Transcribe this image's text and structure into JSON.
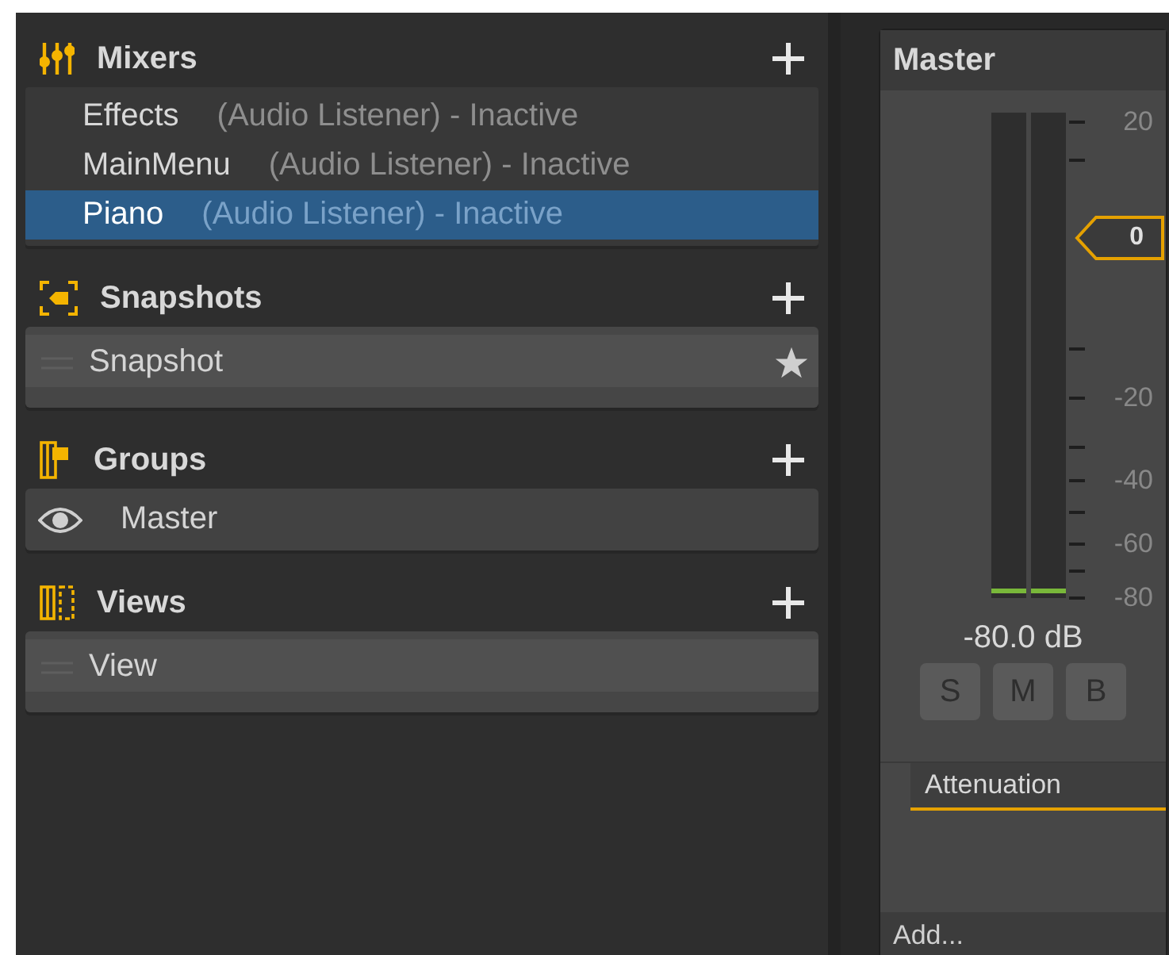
{
  "mixers": {
    "title": "Mixers",
    "items": [
      {
        "name": "Effects",
        "info": "(Audio Listener) - Inactive",
        "selected": false
      },
      {
        "name": "MainMenu",
        "info": "(Audio Listener) - Inactive",
        "selected": false
      },
      {
        "name": "Piano",
        "info": "(Audio Listener) - Inactive",
        "selected": true
      }
    ]
  },
  "snapshots": {
    "title": "Snapshots",
    "items": [
      {
        "name": "Snapshot",
        "starred": true
      }
    ]
  },
  "groups": {
    "title": "Groups",
    "items": [
      {
        "name": "Master",
        "visible": true
      }
    ]
  },
  "views": {
    "title": "Views",
    "items": [
      {
        "name": "View"
      }
    ]
  },
  "channel": {
    "title": "Master",
    "scale": [
      "20",
      "-20",
      "-40",
      "-60",
      "-80"
    ],
    "fader": "0",
    "meters": [
      {
        "level": 0.02
      },
      {
        "level": 0.02
      }
    ],
    "reading": "-80.0 dB",
    "buttons": [
      "S",
      "M",
      "B"
    ],
    "effects": [
      "Attenuation"
    ],
    "add": "Add..."
  }
}
